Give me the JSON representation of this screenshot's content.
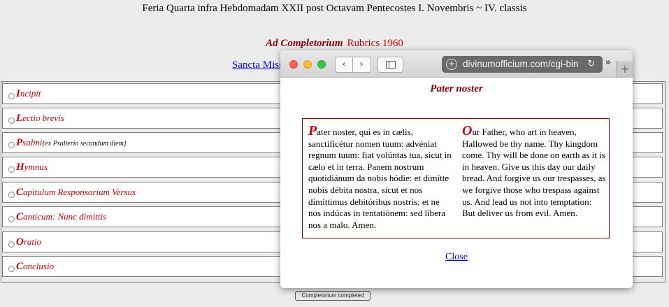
{
  "page": {
    "title": "Feria Quarta infra Hebdomadam XXII post Octavam Pentecostes I. Novembris ~ IV. classis",
    "hour_name": "Ad Completorium",
    "rubrics": "Rubrics 1960",
    "missa_link": "Sancta Missa"
  },
  "sections": [
    {
      "cap": "I",
      "rest": "ncipit",
      "sub": ""
    },
    {
      "cap": "L",
      "rest": "ectio brevis",
      "sub": ""
    },
    {
      "cap": "P",
      "rest": "salmi",
      "sub": "{ex Psalterio secundum diem}"
    },
    {
      "cap": "H",
      "rest": "ymnus",
      "sub": ""
    },
    {
      "cap": "C",
      "rest": "apitulum Responsorium Versus",
      "sub": ""
    },
    {
      "cap": "C",
      "rest": "anticum: Nunc dimittis",
      "sub": ""
    },
    {
      "cap": "O",
      "rest": "ratio",
      "sub": ""
    },
    {
      "cap": "C",
      "rest": "onclusio",
      "sub": ""
    }
  ],
  "status_button": "Completorium completed",
  "browser": {
    "address": "divinumofficium.com/cgi-bin",
    "plus_glyph": "+",
    "back_glyph": "‹",
    "forward_glyph": "›",
    "reload_glyph": "↻",
    "overflow_glyph": "»",
    "newtab_glyph": "+"
  },
  "popup": {
    "title": "Pater noster",
    "latin_initial": "P",
    "latin_text": "ater noster, qui es in cælis, sanctificétur nomen tuum: advéniat regnum tuum: fiat volúntas tua, sicut in cælo et in terra. Panem nostrum quotidiánum da nobis hódie: et dimítte nobis débita nostra, sicut et nos dimíttimus debitóribus nostris: et ne nos indúcas in tentatiónem: sed líbera nos a malo. Amen.",
    "english_initial": "O",
    "english_text": "ur Father, who art in heaven, Hallowed be thy name. Thy kingdom come. Thy will be done on earth as it is in heaven. Give us this day our daily bread. And forgive us our trespasses, as we forgive those who trespass against us. And lead us not into temptation: But deliver us from evil. Amen.",
    "close_label": "Close"
  },
  "colors": {
    "rubric_red": "#cc0000",
    "title_red": "#8b0000",
    "link_blue": "#0000ee"
  }
}
